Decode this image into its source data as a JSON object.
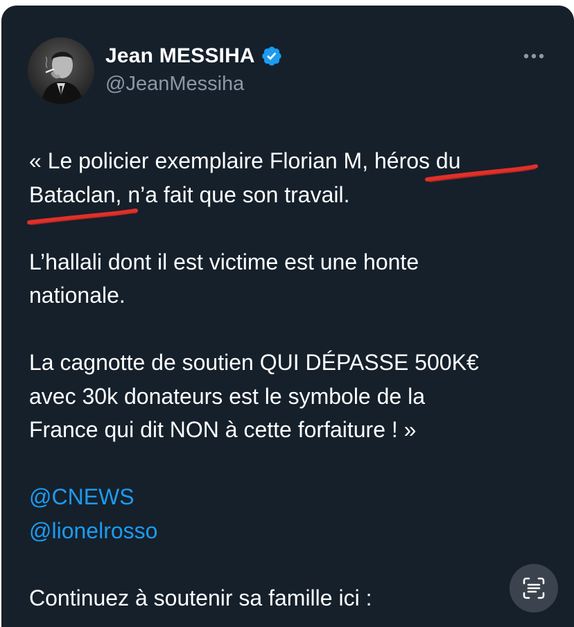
{
  "author": {
    "display_name": "Jean MESSIHA",
    "handle": "@JeanMessiha",
    "verified": true,
    "avatar_icon": "profile-photo"
  },
  "tweet": {
    "line1": "« Le policier exemplaire Florian M, héros du",
    "line2": "Bataclan, n’a fait que son travail.",
    "para2": "L’hallali dont il est victime est une honte\nnationale.",
    "para3": "La cagnotte de soutien QUI DÉPASSE 500K€\navec 30k donateurs est le symbole de la\nFrance qui dit NON à cette forfaiture ! »",
    "mentions": [
      "@CNEWS",
      "@lionelrosso"
    ],
    "para4": "Continuez à soutenir sa famille ici :"
  },
  "icons": {
    "more": "more-horizontal-icon",
    "verified": "verified-badge-icon",
    "text_scan": "live-text-icon"
  },
  "colors": {
    "background": "#15202b",
    "text": "#ffffff",
    "secondary": "#8b98a5",
    "link": "#1d9bf0",
    "verified": "#1d9bf0",
    "annotation": "#e0302a"
  }
}
